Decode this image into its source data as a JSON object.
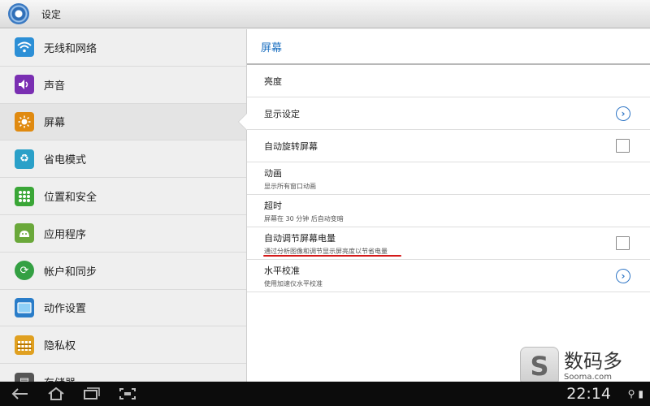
{
  "window": {
    "title": "设定"
  },
  "sidebar": {
    "items": [
      {
        "label": "无线和网络",
        "icon": "wifi-icon",
        "color": "#2c8fd6"
      },
      {
        "label": "声音",
        "icon": "speaker-icon",
        "color": "#7a2fb2"
      },
      {
        "label": "屏幕",
        "icon": "brightness-icon",
        "color": "#e08a10"
      },
      {
        "label": "省电模式",
        "icon": "recycle-icon",
        "color": "#2aa0c8"
      },
      {
        "label": "位置和安全",
        "icon": "grid-lock-icon",
        "color": "#3aa637"
      },
      {
        "label": "应用程序",
        "icon": "android-app-icon",
        "color": "#6aa83a"
      },
      {
        "label": "帐户和同步",
        "icon": "sync-icon",
        "color": "#34a043"
      },
      {
        "label": "动作设置",
        "icon": "screen-icon",
        "color": "#2a7dc9"
      },
      {
        "label": "隐私权",
        "icon": "fence-icon",
        "color": "#e0a020"
      },
      {
        "label": "存储器",
        "icon": "sdcard-icon",
        "color": "#555555"
      }
    ],
    "active_index": 2
  },
  "content": {
    "header": "屏幕",
    "rows": {
      "brightness": {
        "title": "亮度"
      },
      "display": {
        "title": "显示设定"
      },
      "autorotate": {
        "title": "自动旋转屏幕"
      },
      "animation": {
        "title": "动画",
        "subtitle": "显示所有窗口动画"
      },
      "timeout": {
        "title": "超时",
        "subtitle": "屏幕在 30 分钟 后自动变暗"
      },
      "autopower": {
        "title": "自动调节屏幕电量",
        "subtitle": "通过分析图像和调节显示屏亮度以节省电量"
      },
      "calibration": {
        "title": "水平校准",
        "subtitle": "使用加速仪水平校准"
      }
    }
  },
  "navbar": {
    "clock": "22:14"
  },
  "watermark": {
    "main": "数码多",
    "sub": "Sooma.com"
  },
  "colors": {
    "accent": "#1b6fc0",
    "underline": "#d41a1a"
  }
}
